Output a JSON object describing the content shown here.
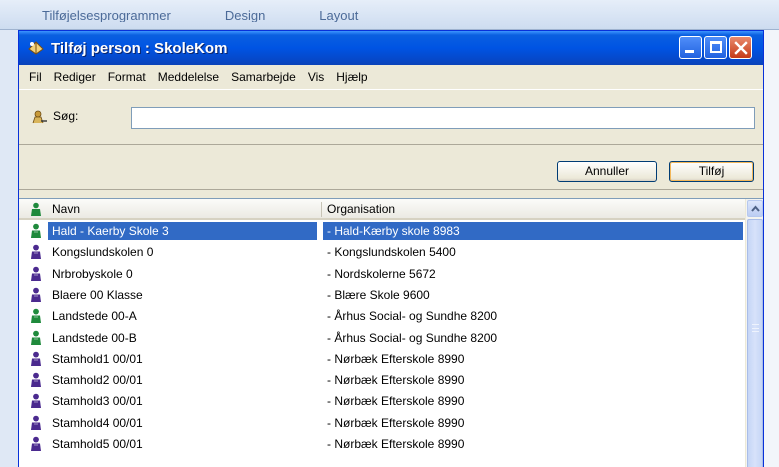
{
  "background_app": {
    "tabs": [
      "Tilføjelsesprogrammer",
      "Design",
      "Layout"
    ]
  },
  "window": {
    "title": "Tilføj person : SkoleKom"
  },
  "menu": {
    "items": [
      "Fil",
      "Rediger",
      "Format",
      "Meddelelse",
      "Samarbejde",
      "Vis",
      "Hjælp"
    ]
  },
  "search": {
    "label": "Søg:",
    "value": ""
  },
  "buttons": {
    "cancel_label": "Annuller",
    "add_label": "Tilføj"
  },
  "list": {
    "columns": [
      "Navn",
      "Organisation"
    ],
    "rows": [
      {
        "name": "Hald - Kaerby Skole 3",
        "organisation": "- Hald-Kærby skole 8983",
        "selected": true,
        "icon": "user-green-icon"
      },
      {
        "name": "Kongslundskolen 0",
        "organisation": "- Kongslundskolen 5400",
        "selected": false,
        "icon": "user-purple-icon"
      },
      {
        "name": "Nrbrobyskole 0",
        "organisation": "- Nordskolerne 5672",
        "selected": false,
        "icon": "user-purple-icon"
      },
      {
        "name": "Blaere 00 Klasse",
        "organisation": "- Blære Skole 9600",
        "selected": false,
        "icon": "user-purple-icon"
      },
      {
        "name": "Landstede 00-A",
        "organisation": "- Århus Social- og Sundhe 8200",
        "selected": false,
        "icon": "user-green-icon"
      },
      {
        "name": "Landstede 00-B",
        "organisation": "- Århus Social- og Sundhe 8200",
        "selected": false,
        "icon": "user-green-icon"
      },
      {
        "name": "Stamhold1 00/01",
        "organisation": "- Nørbæk Efterskole 8990",
        "selected": false,
        "icon": "user-purple-icon"
      },
      {
        "name": "Stamhold2 00/01",
        "organisation": "- Nørbæk Efterskole 8990",
        "selected": false,
        "icon": "user-purple-icon"
      },
      {
        "name": "Stamhold3 00/01",
        "organisation": "- Nørbæk Efterskole 8990",
        "selected": false,
        "icon": "user-purple-icon"
      },
      {
        "name": "Stamhold4 00/01",
        "organisation": "- Nørbæk Efterskole 8990",
        "selected": false,
        "icon": "user-purple-icon"
      },
      {
        "name": "Stamhold5 00/01",
        "organisation": "- Nørbæk Efterskole 8990",
        "selected": false,
        "icon": "user-purple-icon"
      }
    ]
  },
  "colors": {
    "titlebar": "#0054e3",
    "selection": "#316ac5",
    "dialog_bg": "#ece9d8",
    "user_green": "#1f8a3c",
    "user_purple": "#4b2a8f"
  }
}
